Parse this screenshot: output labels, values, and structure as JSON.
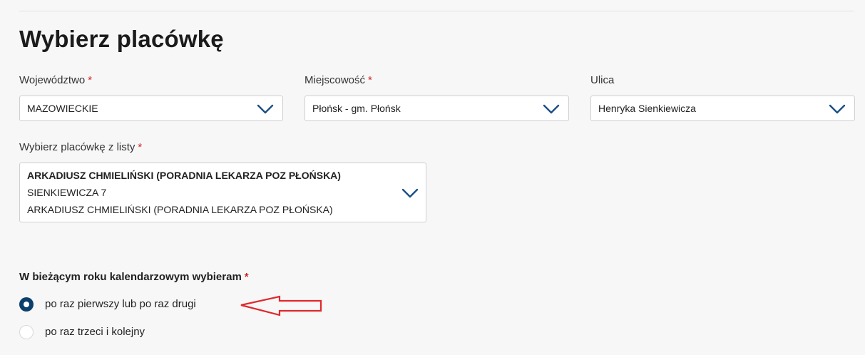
{
  "title": "Wybierz placówkę",
  "required_mark": "*",
  "fields": {
    "wojewodztwo": {
      "label": "Województwo",
      "value": "MAZOWIECKIE",
      "required": true
    },
    "miejscowosc": {
      "label": "Miejscowość",
      "value": "Płońsk - gm. Płońsk",
      "required": true
    },
    "ulica": {
      "label": "Ulica",
      "value": "Henryka Sienkiewicza",
      "required": false
    },
    "placowka": {
      "label": "Wybierz placówkę z listy",
      "required": true,
      "name": "ARKADIUSZ CHMIELIŃSKI (PORADNIA LEKARZA POZ PŁOŃSKA)",
      "address": "SIENKIEWICZA 7",
      "subtitle": "ARKADIUSZ CHMIELIŃSKI (PORADNIA LEKARZA POZ PŁOŃSKA)"
    }
  },
  "choice": {
    "label": "W bieżącym roku kalendarzowym wybieram",
    "required": true,
    "options": [
      {
        "label": "po raz pierwszy lub po raz drugi",
        "selected": true
      },
      {
        "label": "po raz trzeci i kolejny",
        "selected": false
      }
    ]
  },
  "icons": {
    "dropdown": "chevron-down-icon",
    "annotation": "arrow-left-outline-icon"
  },
  "colors": {
    "accent": "#0c3f6b",
    "required": "#d32020",
    "annotation": "#e0282d",
    "chevron": "#1a4f86"
  }
}
